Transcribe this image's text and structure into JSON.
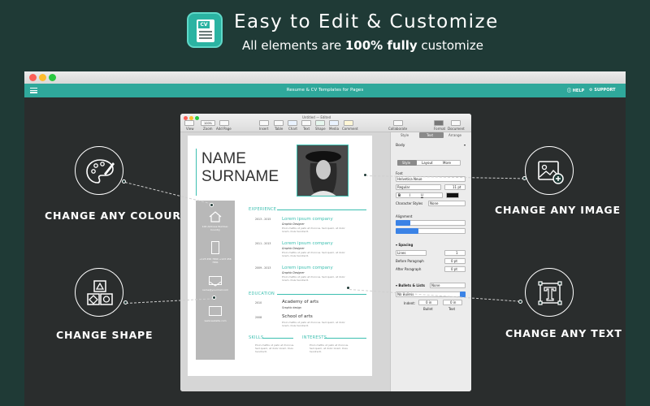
{
  "banner": {
    "icon_text": "CV",
    "title": "Easy to Edit & Customize",
    "subtitle_pre": "All elements are ",
    "subtitle_bold": "100% fully",
    "subtitle_post": " customize"
  },
  "app": {
    "window_title": "Resume & CV Templates for Pages",
    "help_label": "HELP",
    "support_label": "SUPPORT",
    "accent_color": "#2fa89b"
  },
  "pages": {
    "doc_title": "Untitled — Edited",
    "toolbar": {
      "view": "View",
      "zoom_value": "100%",
      "zoom": "Zoom",
      "add_page": "Add Page",
      "insert": "Insert",
      "table": "Table",
      "chart": "Chart",
      "text": "Text",
      "shape": "Shape",
      "media": "Media",
      "comment": "Comment",
      "collaborate": "Collaborate",
      "format": "Format",
      "document": "Document"
    },
    "inspector": {
      "tabs": [
        "Style",
        "Text",
        "Arrange"
      ],
      "paragraph_style": "Body",
      "subtabs": [
        "Style",
        "Layout",
        "More"
      ],
      "font_label": "Font",
      "font_family": "Helvetica Neue",
      "font_weight": "Regular",
      "font_size": "11 pt",
      "char_styles_label": "Character Styles",
      "char_styles_value": "None",
      "alignment_label": "Alignment",
      "spacing_label": "Spacing",
      "spacing_mode": "Lines",
      "spacing_value": "1",
      "before_para_label": "Before Paragraph",
      "before_para_value": "0 pt",
      "after_para_label": "After Paragraph",
      "after_para_value": "0 pt",
      "bullets_label": "Bullets & Lists",
      "bullets_value": "None",
      "no_bullets": "No Bullets",
      "indent_label": "Indent:",
      "indent_bullet_value": "0 in",
      "indent_text_value": "0 in",
      "bullet_col": "Bullet",
      "text_col": "Text"
    },
    "resume": {
      "name_line1": "NAME",
      "name_line2": "SURNAME",
      "experience_head": "EXPERIENCE",
      "education_head": "EDUCATION",
      "skills_head": "SKILLS",
      "interests_head": "INTERESTS",
      "contact_address": "100 Address Number, Country",
      "contact_phone": "+123 456 7890 +123 456 7891",
      "contact_email": "name@yourmail.com",
      "contact_web": "www.website.com",
      "jobs": [
        {
          "date": "2013 - 2015",
          "company": "Lorem ipsum company",
          "role": "Graphic Designer",
          "desc": "Proin mattis ut justo et rhoncus. Sed quam, at dolor lorem. Duis hendrerit."
        },
        {
          "date": "2011 - 2013",
          "company": "Lorem ipsum company",
          "role": "Graphic Designer",
          "desc": "Proin mattis ut justo et rhoncus. Sed quam, at dolor lorem. Duis hendrerit."
        },
        {
          "date": "2009 - 2013",
          "company": "Lorem ipsum company",
          "role": "Graphic Designer",
          "desc": "Proin mattis ut justo et rhoncus. Sed quam, at dolor lorem. Duis hendrerit."
        }
      ],
      "education": [
        {
          "date": "2010",
          "title": "Academy of arts",
          "sub": "Graphic design"
        },
        {
          "date": "2008",
          "title": "School of arts",
          "sub": "Proin mattis ut justo et rhoncus. Sed quam, at dolor lorem. Duis hendrerit."
        }
      ],
      "skills_text": "Proin mattis ut justo et rhoncus. Sed quam, at dolor lorem. Duis hendrerit.",
      "interests_text": "Proin mattis ut justo et rhoncus. Sed quam, at dolor lorem. Duis hendrerit."
    }
  },
  "callouts": {
    "colour": "CHANGE ANY COLOUR",
    "shape": "CHANGE SHAPE",
    "image": "CHANGE ANY IMAGE",
    "text": "CHANGE ANY TEXT"
  }
}
